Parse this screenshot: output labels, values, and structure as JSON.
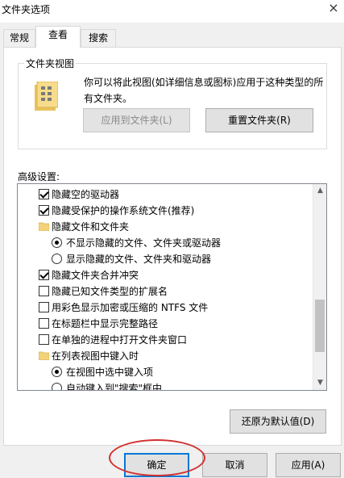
{
  "window": {
    "title": "文件夹选项",
    "close_glyph": "×"
  },
  "tabs": [
    {
      "label": "常规",
      "active": false
    },
    {
      "label": "查看",
      "active": true
    },
    {
      "label": "搜索",
      "active": false
    }
  ],
  "folder_view": {
    "group_title": "文件夹视图",
    "description_line1": "你可以将此视图(如详细信息或图标)应用于这种类型的所",
    "description_line2": "有文件夹。",
    "apply_button": "应用到文件夹(L)",
    "reset_button": "重置文件夹(R)"
  },
  "advanced": {
    "label": "高级设置:",
    "items": [
      {
        "type": "checkbox",
        "checked": true,
        "label": "隐藏空的驱动器"
      },
      {
        "type": "checkbox",
        "checked": true,
        "label": "隐藏受保护的操作系统文件(推荐)"
      },
      {
        "type": "folder",
        "label": "隐藏文件和文件夹"
      },
      {
        "type": "radio",
        "checked": true,
        "label": "不显示隐藏的文件、文件夹或驱动器"
      },
      {
        "type": "radio",
        "checked": false,
        "label": "显示隐藏的文件、文件夹和驱动器"
      },
      {
        "type": "checkbox",
        "checked": true,
        "label": "隐藏文件夹合并冲突"
      },
      {
        "type": "checkbox",
        "checked": false,
        "label": "隐藏已知文件类型的扩展名"
      },
      {
        "type": "checkbox",
        "checked": false,
        "label": "用彩色显示加密或压缩的 NTFS 文件"
      },
      {
        "type": "checkbox",
        "checked": false,
        "label": "在标题栏中显示完整路径"
      },
      {
        "type": "checkbox",
        "checked": false,
        "label": "在单独的进程中打开文件夹窗口"
      },
      {
        "type": "folder",
        "label": "在列表视图中键入时"
      },
      {
        "type": "radio",
        "checked": true,
        "label": "在视图中选中键入项"
      },
      {
        "type": "radio",
        "checked": false,
        "label": "自动键入到\"搜索\"框中"
      }
    ],
    "restore_button": "还原为默认值(D)"
  },
  "footer": {
    "ok_button": "确定",
    "cancel_button": "取消",
    "apply_button": "应用(A)"
  },
  "colors": {
    "accent": "#0078d7",
    "annotation_ring": "#d32f2f",
    "folder": "#f3d27a"
  }
}
